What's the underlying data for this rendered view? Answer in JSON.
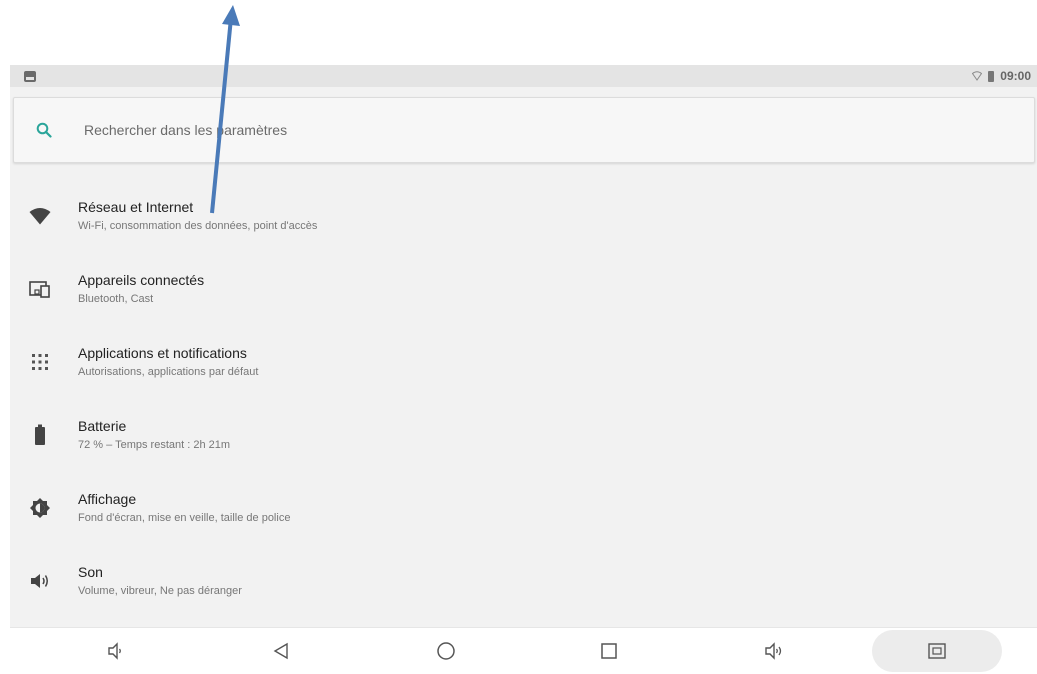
{
  "status_bar": {
    "time": "09:00"
  },
  "search": {
    "placeholder": "Rechercher dans les paramètres"
  },
  "settings": [
    {
      "title": "Réseau et Internet",
      "subtitle": "Wi-Fi, consommation des données, point d'accès",
      "icon": "wifi-icon"
    },
    {
      "title": "Appareils connectés",
      "subtitle": "Bluetooth, Cast",
      "icon": "devices-icon"
    },
    {
      "title": "Applications et notifications",
      "subtitle": "Autorisations, applications par défaut",
      "icon": "apps-grid-icon"
    },
    {
      "title": "Batterie",
      "subtitle": "72 % – Temps restant : 2h 21m",
      "icon": "battery-icon"
    },
    {
      "title": "Affichage",
      "subtitle": "Fond d'écran, mise en veille, taille de police",
      "icon": "brightness-icon"
    },
    {
      "title": "Son",
      "subtitle": "Volume, vibreur, Ne pas déranger",
      "icon": "volume-icon"
    }
  ],
  "nav_bar": {
    "buttons": [
      "volume-down-icon",
      "back-icon",
      "home-icon",
      "recents-icon",
      "volume-up-icon",
      "screenshot-icon"
    ]
  },
  "colors": {
    "accent": "#2aa59a",
    "annotation_arrow": "#4a7ab8",
    "panel_bg": "#f2f2f2",
    "status_bar_bg": "#e4e4e4"
  }
}
